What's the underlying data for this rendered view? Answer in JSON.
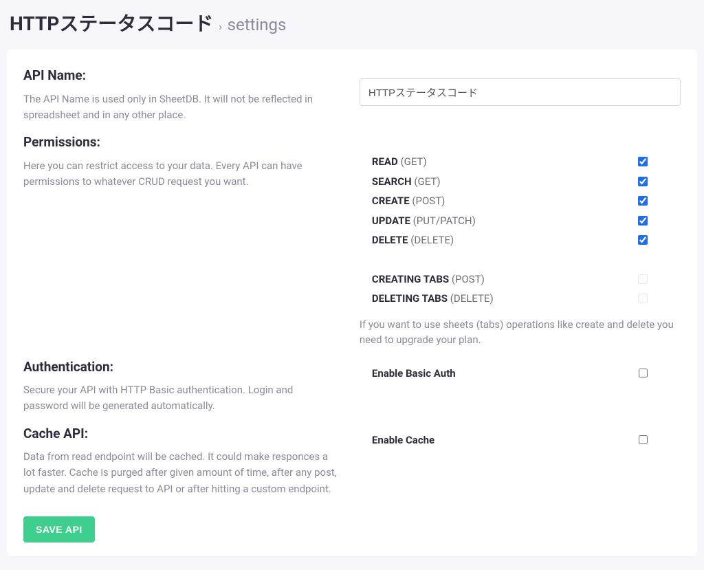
{
  "breadcrumb": {
    "title": "HTTPステータスコード",
    "sub": "settings"
  },
  "apiName": {
    "heading": "API Name:",
    "desc": "The API Name is used only in SheetDB. It will not be reflected in spreadsheet and in any other place.",
    "value": "HTTPステータスコード"
  },
  "permissions": {
    "heading": "Permissions:",
    "desc": "Here you can restrict access to your data. Every API can have permissions to whatever CRUD request you want.",
    "items": [
      {
        "name": "READ",
        "paren": "(GET)",
        "checked": true,
        "disabled": false
      },
      {
        "name": "SEARCH",
        "paren": "(GET)",
        "checked": true,
        "disabled": false
      },
      {
        "name": "CREATE",
        "paren": "(POST)",
        "checked": true,
        "disabled": false
      },
      {
        "name": "UPDATE",
        "paren": "(PUT/PATCH)",
        "checked": true,
        "disabled": false
      },
      {
        "name": "DELETE",
        "paren": "(DELETE)",
        "checked": true,
        "disabled": false
      }
    ],
    "tabsItems": [
      {
        "name": "CREATING TABS",
        "paren": "(POST)",
        "checked": false,
        "disabled": true
      },
      {
        "name": "DELETING TABS",
        "paren": "(DELETE)",
        "checked": false,
        "disabled": true
      }
    ],
    "tabsNote": "If you want to use sheets (tabs) operations like create and delete you need to upgrade your plan."
  },
  "authentication": {
    "heading": "Authentication:",
    "desc": "Secure your API with HTTP Basic authentication. Login and password will be generated automatically.",
    "label": "Enable Basic Auth",
    "checked": false
  },
  "cache": {
    "heading": "Cache API:",
    "desc": "Data from read endpoint will be cached. It could make responces a lot faster. Cache is purged after given amount of time, after any post, update and delete request to API or after hitting a custom endpoint.",
    "label": "Enable Cache",
    "checked": false
  },
  "saveButton": "SAVE API"
}
